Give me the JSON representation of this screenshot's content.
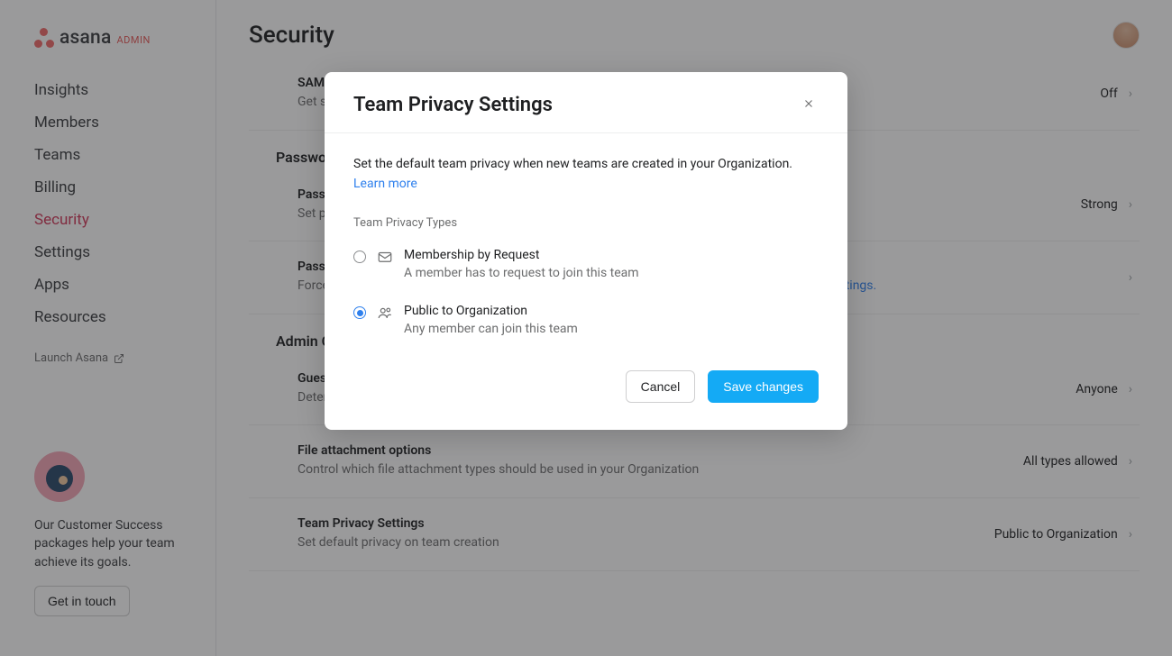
{
  "brand": {
    "name": "asana",
    "suffix": "ADMIN"
  },
  "sidebar": {
    "items": [
      {
        "label": "Insights"
      },
      {
        "label": "Members"
      },
      {
        "label": "Teams"
      },
      {
        "label": "Billing"
      },
      {
        "label": "Security"
      },
      {
        "label": "Settings"
      },
      {
        "label": "Apps"
      },
      {
        "label": "Resources"
      }
    ],
    "active_index": 4,
    "launch_label": "Launch Asana",
    "cs_text": "Our Customer Success packages help your team achieve its goals.",
    "cs_button": "Get in touch"
  },
  "page": {
    "title": "Security",
    "groups": [
      {
        "heading": null,
        "rows": [
          {
            "title": "SAML",
            "desc": "Get s",
            "value": "Off"
          }
        ]
      },
      {
        "heading": "Passwo",
        "rows": [
          {
            "title": "Passw",
            "desc": "Set p",
            "value": "Strong"
          },
          {
            "title": "Passw",
            "desc": "Force",
            "desc_link": "ofile settings.",
            "value": ""
          }
        ]
      },
      {
        "heading": "Admin C",
        "rows": [
          {
            "title": "Guest invites",
            "info": true,
            "desc": "Determine who's authorized to invite guests into your Organization.",
            "value": "Anyone"
          },
          {
            "title": "File attachment options",
            "desc": "Control which file attachment types should be used in your Organization",
            "value": "All types allowed"
          },
          {
            "title": "Team Privacy Settings",
            "desc": "Set default privacy on team creation",
            "value": "Public to Organization"
          }
        ]
      }
    ]
  },
  "modal": {
    "title": "Team Privacy Settings",
    "description": "Set the default team privacy when new teams are created in your Organization.",
    "learn_more": "Learn more",
    "types_label": "Team Privacy Types",
    "options": [
      {
        "title": "Membership by Request",
        "sub": "A member has to request to join this team",
        "checked": false,
        "icon": "envelope"
      },
      {
        "title": "Public to Organization",
        "sub": "Any member can join this team",
        "checked": true,
        "icon": "people"
      }
    ],
    "cancel": "Cancel",
    "save": "Save changes"
  }
}
